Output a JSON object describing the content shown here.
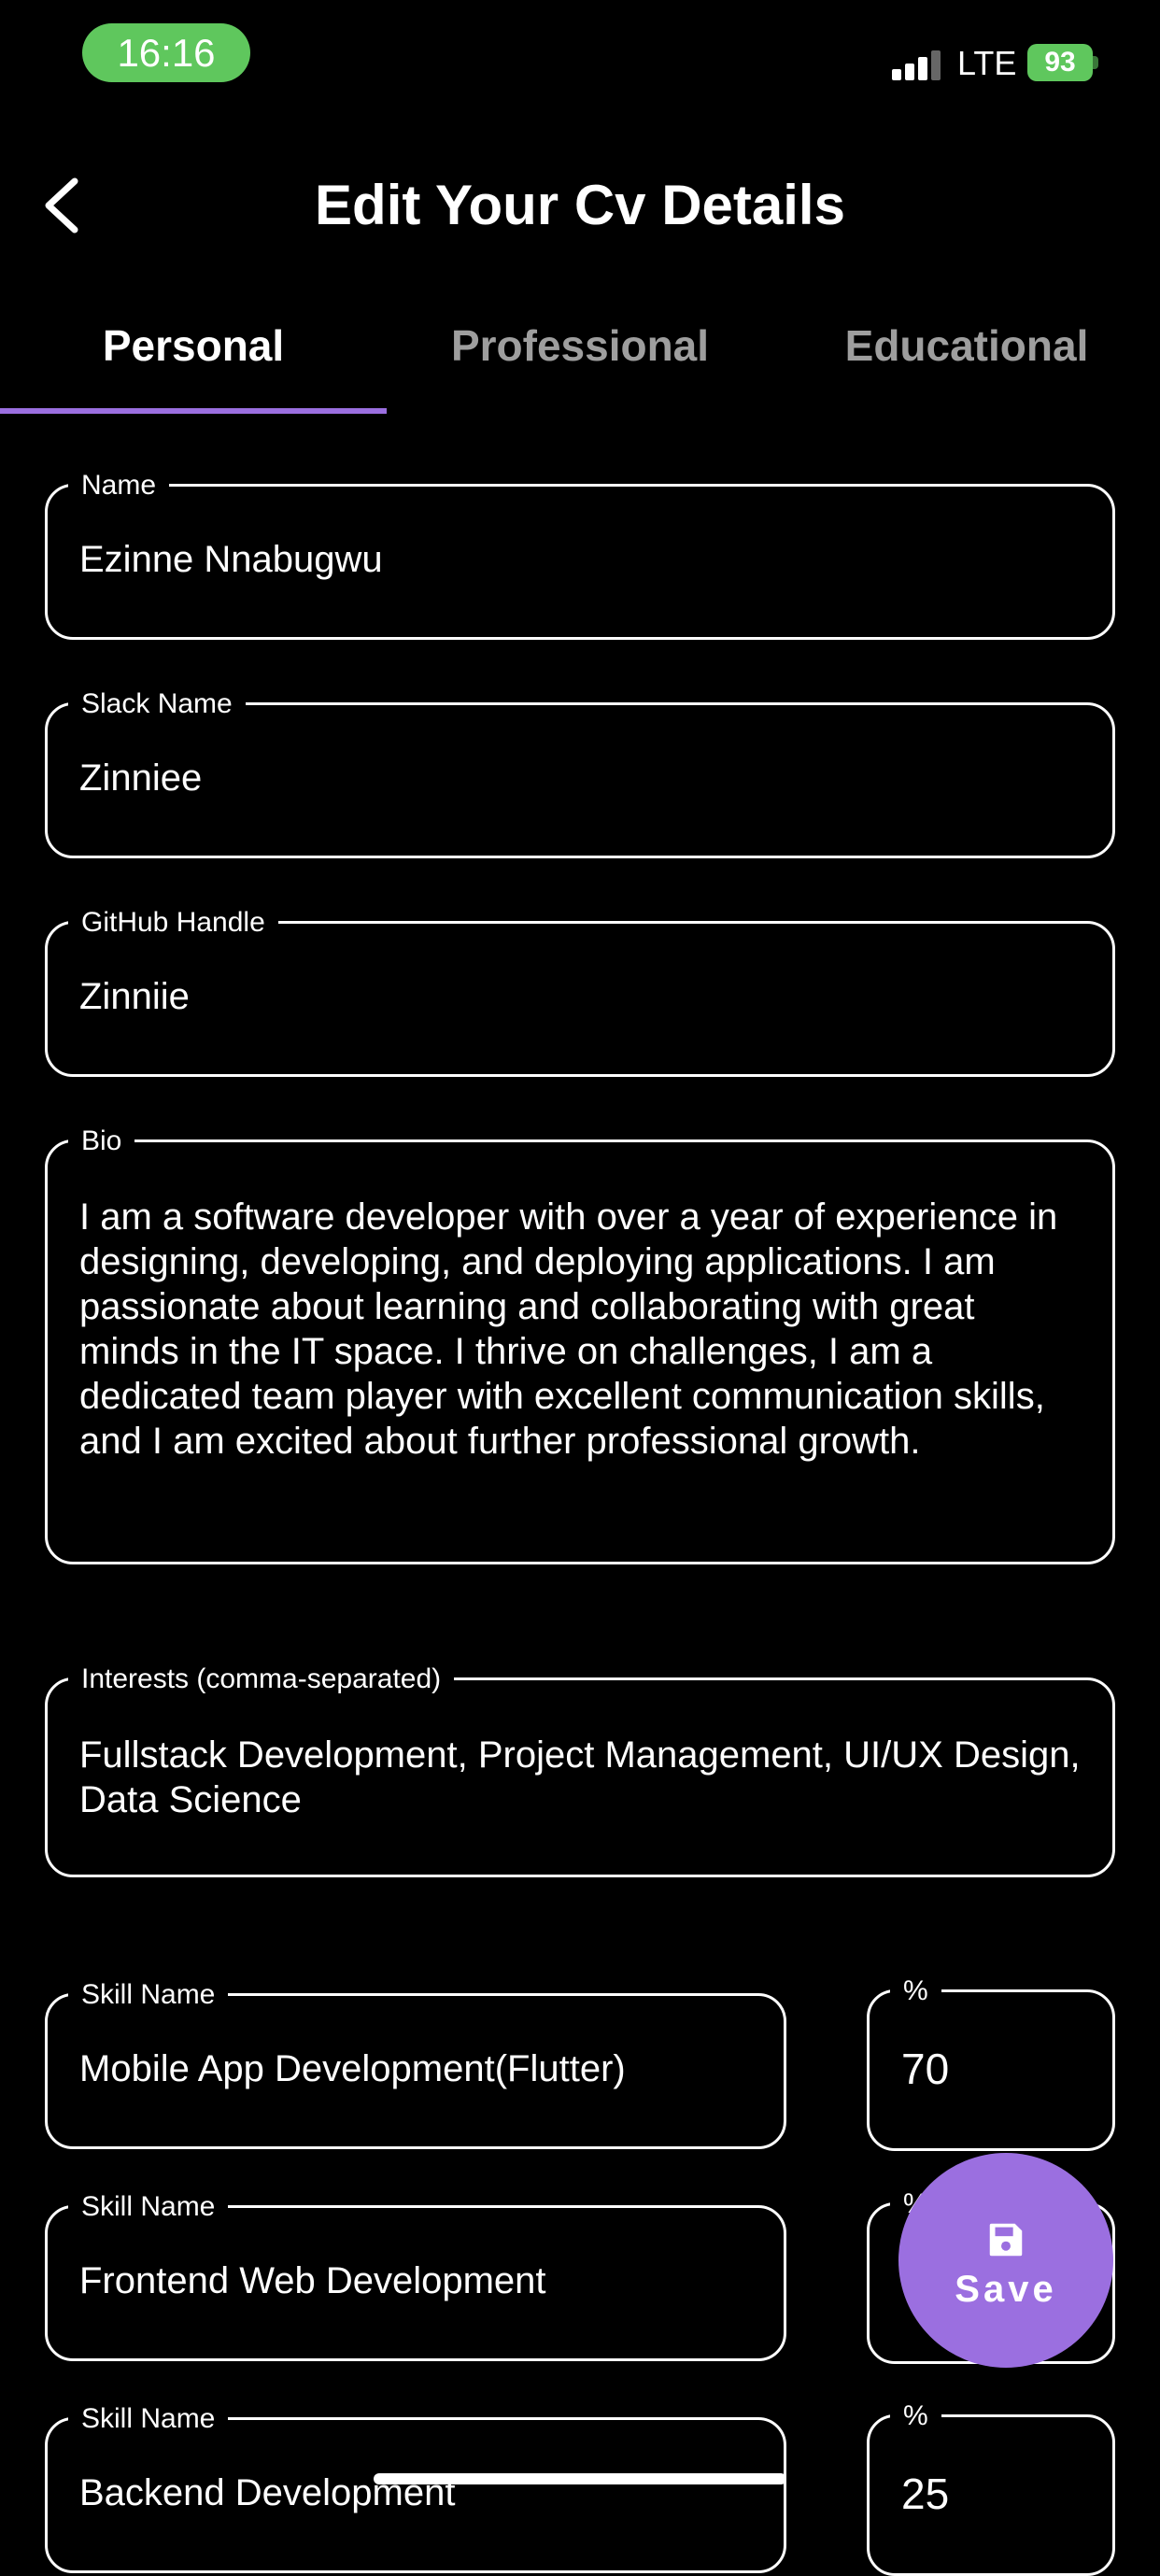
{
  "status_bar": {
    "time": "16:16",
    "network": "LTE",
    "battery": "93"
  },
  "header": {
    "title": "Edit Your Cv Details"
  },
  "tabs": [
    {
      "label": "Personal",
      "active": true
    },
    {
      "label": "Professional",
      "active": false
    },
    {
      "label": "Educational",
      "active": false
    }
  ],
  "fields": {
    "name": {
      "label": "Name",
      "value": "Ezinne Nnabugwu"
    },
    "slack": {
      "label": "Slack Name",
      "value": "Zinniee"
    },
    "github": {
      "label": "GitHub Handle",
      "value": "Zinniie"
    },
    "bio": {
      "label": "Bio",
      "value": "I am a software developer with over a year of experience in designing, developing, and deploying applications. I am passionate about learning and collaborating with great minds in the IT space. I thrive on challenges, I am a dedicated team player with excellent communication skills, and I am excited about further professional growth."
    },
    "interests": {
      "label": "Interests (comma-separated)",
      "value": "Fullstack Development, Project Management, UI/UX Design, Data Science"
    }
  },
  "skills": [
    {
      "name_label": "Skill Name",
      "name": "Mobile App Development(Flutter)",
      "percent_label": "%",
      "percent": "70"
    },
    {
      "name_label": "Skill Name",
      "name": "Frontend Web Development",
      "percent_label": "%",
      "percent": ""
    },
    {
      "name_label": "Skill Name",
      "name": "Backend Development",
      "percent_label": "%",
      "percent": "25"
    }
  ],
  "fab": {
    "label": "Save",
    "icon": "save-icon"
  },
  "colors": {
    "accent": "#9b6fe0",
    "background": "#000000",
    "time_pill": "#5fc75d"
  }
}
